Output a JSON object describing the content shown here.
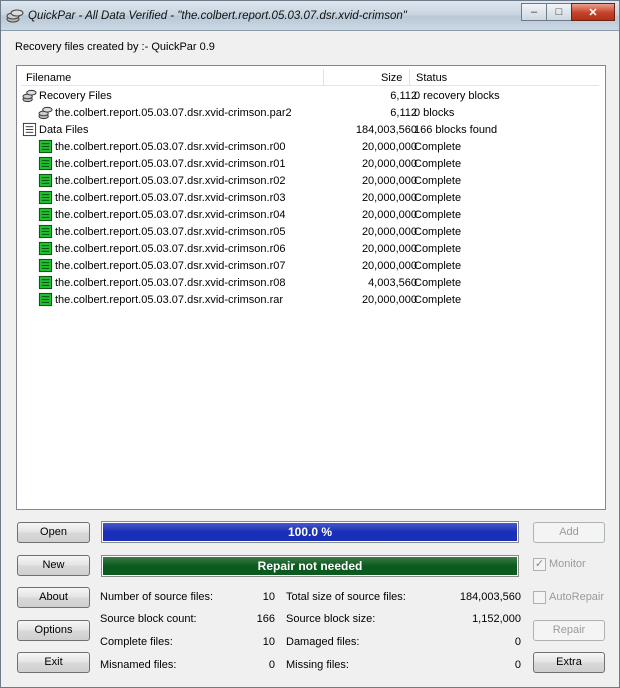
{
  "window": {
    "title": "QuickPar - All Data Verified - \"the.colbert.report.05.03.07.dsr.xvid-crimson\"",
    "controls": {
      "minimize": "–",
      "maximize": "□",
      "close": "✕"
    }
  },
  "created_by": "Recovery files created by :- QuickPar 0.9",
  "list": {
    "headers": {
      "filename": "Filename",
      "size": "Size",
      "status": "Status"
    },
    "groups": [
      {
        "name": "Recovery Files",
        "size": "6,112",
        "status": "0 recovery blocks",
        "icon": "coins-icon",
        "items": [
          {
            "name": "the.colbert.report.05.03.07.dsr.xvid-crimson.par2",
            "size": "6,112",
            "status": "0 blocks",
            "icon": "coins-icon"
          }
        ]
      },
      {
        "name": "Data Files",
        "size": "184,003,560",
        "status": "166 blocks found",
        "icon": "file-list-icon",
        "items": [
          {
            "name": "the.colbert.report.05.03.07.dsr.xvid-crimson.r00",
            "size": "20,000,000",
            "status": "Complete",
            "icon": "green-file-icon"
          },
          {
            "name": "the.colbert.report.05.03.07.dsr.xvid-crimson.r01",
            "size": "20,000,000",
            "status": "Complete",
            "icon": "green-file-icon"
          },
          {
            "name": "the.colbert.report.05.03.07.dsr.xvid-crimson.r02",
            "size": "20,000,000",
            "status": "Complete",
            "icon": "green-file-icon"
          },
          {
            "name": "the.colbert.report.05.03.07.dsr.xvid-crimson.r03",
            "size": "20,000,000",
            "status": "Complete",
            "icon": "green-file-icon"
          },
          {
            "name": "the.colbert.report.05.03.07.dsr.xvid-crimson.r04",
            "size": "20,000,000",
            "status": "Complete",
            "icon": "green-file-icon"
          },
          {
            "name": "the.colbert.report.05.03.07.dsr.xvid-crimson.r05",
            "size": "20,000,000",
            "status": "Complete",
            "icon": "green-file-icon"
          },
          {
            "name": "the.colbert.report.05.03.07.dsr.xvid-crimson.r06",
            "size": "20,000,000",
            "status": "Complete",
            "icon": "green-file-icon"
          },
          {
            "name": "the.colbert.report.05.03.07.dsr.xvid-crimson.r07",
            "size": "20,000,000",
            "status": "Complete",
            "icon": "green-file-icon"
          },
          {
            "name": "the.colbert.report.05.03.07.dsr.xvid-crimson.r08",
            "size": "4,003,560",
            "status": "Complete",
            "icon": "green-file-icon"
          },
          {
            "name": "the.colbert.report.05.03.07.dsr.xvid-crimson.rar",
            "size": "20,000,000",
            "status": "Complete",
            "icon": "green-file-icon"
          }
        ]
      }
    ]
  },
  "buttons": {
    "open": "Open",
    "new": "New",
    "about": "About",
    "options": "Options",
    "exit": "Exit",
    "add": "Add",
    "repair": "Repair",
    "extra": "Extra"
  },
  "checkboxes": {
    "monitor": {
      "label": "Monitor",
      "checked": true
    },
    "autorepair": {
      "label": "AutoRepair",
      "checked": false
    }
  },
  "progress": {
    "verify": {
      "label": "100.0 %",
      "fraction": 1.0,
      "color": "#1a2fb8"
    },
    "repair": {
      "label": "Repair not needed",
      "fraction": 1.0,
      "color": "#0b5a1e"
    }
  },
  "stats": {
    "source_files_label": "Number of source files:",
    "source_files": "10",
    "total_size_label": "Total size of source files:",
    "total_size": "184,003,560",
    "block_count_label": "Source block count:",
    "block_count": "166",
    "block_size_label": "Source block size:",
    "block_size": "1,152,000",
    "complete_label": "Complete files:",
    "complete": "10",
    "damaged_label": "Damaged files:",
    "damaged": "0",
    "misnamed_label": "Misnamed files:",
    "misnamed": "0",
    "missing_label": "Missing files:",
    "missing": "0"
  }
}
